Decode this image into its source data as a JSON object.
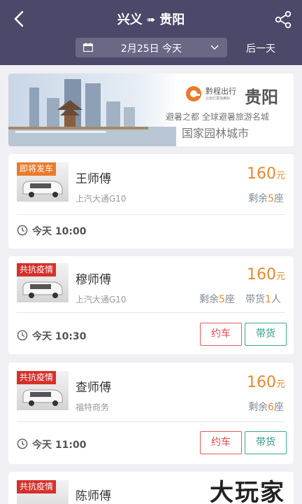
{
  "header": {
    "origin": "兴义",
    "destination": "贵阳",
    "date": "2月25日 今天",
    "next_day": "后一天"
  },
  "banner": {
    "brand_name": "黔程出行",
    "brand_slogan": "让出行更加美好",
    "city": "贵阳",
    "line1": "避暑之都 全球避暑旅游名城",
    "line2": "国家园林城市"
  },
  "trips": [
    {
      "tag": "即将发车",
      "driver": "王师傅",
      "car": "上汽大通G10",
      "price": "160",
      "unit": "元",
      "seats_prefix": "剩余",
      "seats": "5",
      "seats_suffix": "座",
      "time": "今天 10:00"
    },
    {
      "tag": "共抗疫情",
      "driver": "穆师傅",
      "car": "上汽大通G10",
      "price": "160",
      "unit": "元",
      "seats_prefix": "剩余",
      "seats": "5",
      "seats_suffix": "座",
      "cargo_prefix": "带货",
      "cargo": "1",
      "cargo_suffix": "人",
      "time": "今天 10:30",
      "book_label": "约车",
      "cargo_label": "带货"
    },
    {
      "tag": "共抗疫情",
      "driver": "查师傅",
      "car": "福特商务",
      "price": "160",
      "unit": "元",
      "seats_prefix": "剩余",
      "seats": "6",
      "seats_suffix": "座",
      "time": "今天 11:00",
      "book_label": "约车",
      "cargo_label": "带货"
    },
    {
      "tag": "共抗疫情",
      "driver": "陈师傅"
    }
  ],
  "watermark": "大玩家",
  "colors": {
    "header": "#4b4869",
    "accent_orange": "#e8892e",
    "book_red": "#e04848",
    "cargo_green": "#2f9a84"
  }
}
